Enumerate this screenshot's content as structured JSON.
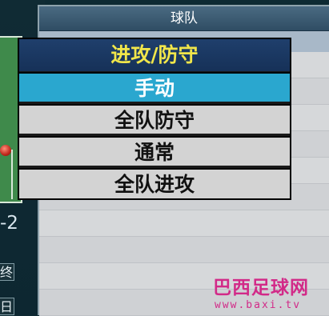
{
  "team_panel": {
    "title": "球队"
  },
  "left_panel": {
    "score_fragment": "-2",
    "button_top_fragment": "终",
    "button_bottom_fragment": "日"
  },
  "menu": {
    "title": "进攻/防守",
    "items": [
      {
        "label": "手动",
        "selected": true
      },
      {
        "label": "全队防守",
        "selected": false
      },
      {
        "label": "通常",
        "selected": false
      },
      {
        "label": "全队进攻",
        "selected": false
      }
    ]
  },
  "watermark": {
    "title": "巴西足球网",
    "url": "www.baxi.tv"
  },
  "colors": {
    "menu_title_text": "#f1e64a",
    "menu_title_bg": "#1f3f6c",
    "selected_item_bg": "#2aa7cf",
    "item_bg": "#d3d3d3",
    "watermark": "#d22a88"
  }
}
